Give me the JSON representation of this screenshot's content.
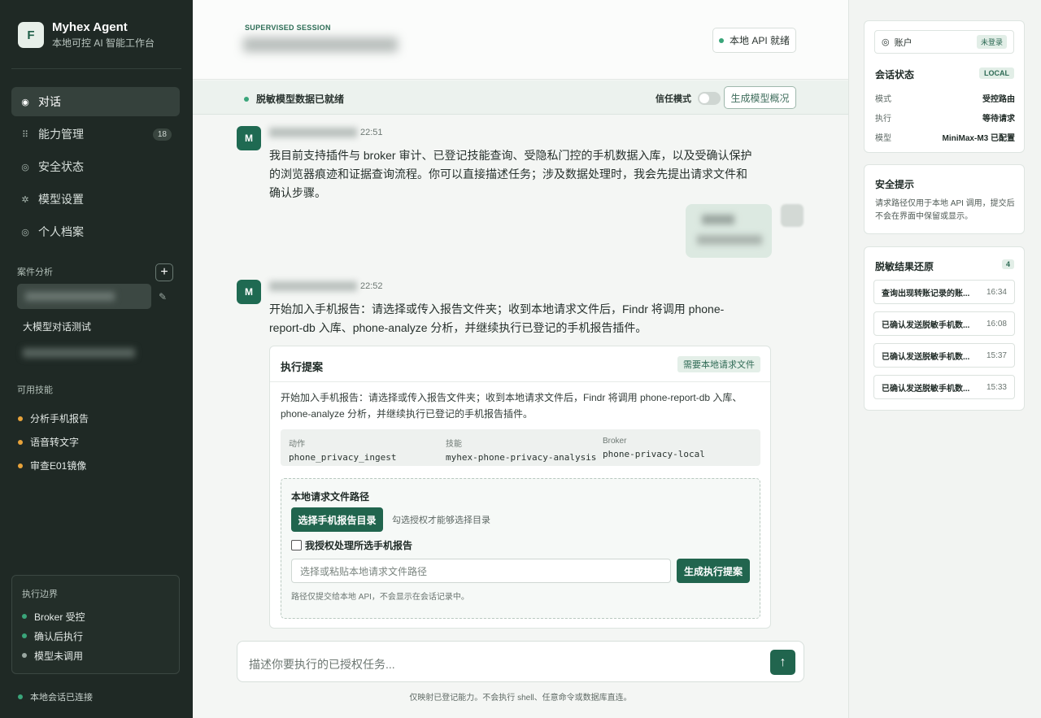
{
  "brand": {
    "logo": "F",
    "title": "Myhex Agent",
    "subtitle": "本地可控 AI 智能工作台"
  },
  "nav": [
    {
      "label": "对话",
      "icon": "chat-circle-icon",
      "glyph": "◉"
    },
    {
      "label": "能力管理",
      "icon": "grid-icon",
      "glyph": "⠿",
      "badge": "18"
    },
    {
      "label": "安全状态",
      "icon": "shield-icon",
      "glyph": "◎"
    },
    {
      "label": "模型设置",
      "icon": "gear-icon",
      "glyph": "✲"
    },
    {
      "label": "个人档案",
      "icon": "profile-icon",
      "glyph": "◎"
    }
  ],
  "cases": {
    "title": "案件分析",
    "add": "+",
    "item": "大模型对话测试"
  },
  "skills": {
    "title": "可用技能",
    "items": [
      "分析手机报告",
      "语音转文字",
      "审查E01镜像"
    ]
  },
  "boundary": {
    "title": "执行边界",
    "items": [
      "Broker 受控",
      "确认后执行",
      "模型未调用"
    ]
  },
  "connection": "本地会话已连接",
  "header": {
    "session_label": "SUPERVISED SESSION",
    "api_status": "本地 API 就绪"
  },
  "statusbar": {
    "text": "脱敏模型数据已就绪",
    "trust_label": "信任模式",
    "generate_label": "生成模型概况"
  },
  "messages": [
    {
      "avatar": "M",
      "time": "22:51",
      "text": "我目前支持插件与 broker 审计、已登记技能查询、受隐私门控的手机数据入库，以及受确认保护的浏览器痕迹和证据查询流程。你可以直接描述任务；涉及数据处理时，我会先提出请求文件和确认步骤。"
    },
    {
      "avatar": "M",
      "time": "22:52",
      "text": "开始加入手机报告：请选择或传入报告文件夹；收到本地请求文件后，Findr 将调用 phone-report-db 入库、phone-analyze 分析，并继续执行已登记的手机报告插件。"
    }
  ],
  "proposal": {
    "title": "执行提案",
    "tag": "需要本地请求文件",
    "desc": "开始加入手机报告：请选择或传入报告文件夹；收到本地请求文件后，Findr 将调用 phone-report-db 入库、phone-analyze 分析，并继续执行已登记的手机报告插件。",
    "action_k": "动作",
    "action_v": "phone_privacy_ingest",
    "skill_k": "技能",
    "skill_v": "myhex-phone-privacy-analysis",
    "broker_k": "Broker",
    "broker_v": "phone-privacy-local",
    "local_title": "本地请求文件路径",
    "pick_label": "选择手机报告目录",
    "pick_hint": "勾选授权才能够选择目录",
    "auth_label": "我授权处理所选手机报告",
    "path_placeholder": "选择或粘贴本地请求文件路径",
    "exec_label": "生成执行提案",
    "note": "路径仅提交给本地 API，不会显示在会话记录中。"
  },
  "composer": {
    "placeholder": "描述你要执行的已授权任务...",
    "send": "↑",
    "footnote": "仅映射已登记能力。不会执行 shell、任意命令或数据库直连。"
  },
  "right": {
    "account_label": "账户",
    "account_tag": "未登录",
    "session_title": "会话状态",
    "session_tag": "LOCAL",
    "rows": [
      {
        "k": "模式",
        "v": "受控路由"
      },
      {
        "k": "执行",
        "v": "等待请求"
      },
      {
        "k": "模型",
        "v": "MiniMax-M3 已配置"
      }
    ],
    "tip_title": "安全提示",
    "tip_text": "请求路径仅用于本地 API 调用，提交后不会在界面中保留或显示。",
    "results_title": "脱敏结果还原",
    "results_count": "4",
    "results": [
      {
        "label": "查询出现转账记录的账...",
        "time": "16:34"
      },
      {
        "label": "已确认发送脱敏手机数...",
        "time": "16:08"
      },
      {
        "label": "已确认发送脱敏手机数...",
        "time": "15:37"
      },
      {
        "label": "已确认发送脱敏手机数...",
        "time": "15:33"
      }
    ]
  }
}
